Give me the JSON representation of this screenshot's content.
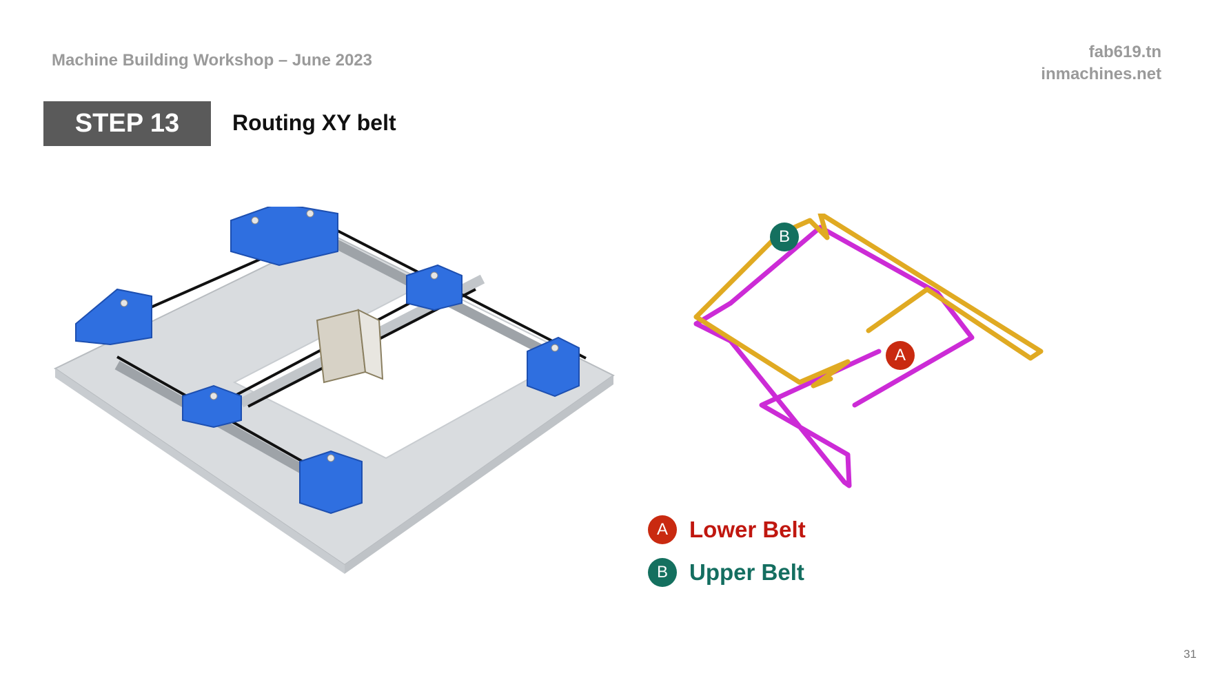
{
  "header": {
    "workshop": "Machine Building Workshop – June 2023",
    "site1": "fab619.tn",
    "site2": "inmachines.net"
  },
  "step": {
    "label": "STEP 13",
    "title": "Routing XY belt"
  },
  "legend": [
    {
      "marker": "A",
      "label": "Lower Belt",
      "color": "#c0170f",
      "marker_color": "#c92a10"
    },
    {
      "marker": "B",
      "label": "Upper Belt",
      "color": "#146e60",
      "marker_color": "#14705f"
    }
  ],
  "callouts": {
    "a": "A",
    "b": "B"
  },
  "colors": {
    "lower_belt": "#cc2bd6",
    "upper_belt": "#e0aa22",
    "bracket_blue": "#2f6fe0",
    "frame_gray": "#d9dcdf"
  },
  "page_number": "31"
}
